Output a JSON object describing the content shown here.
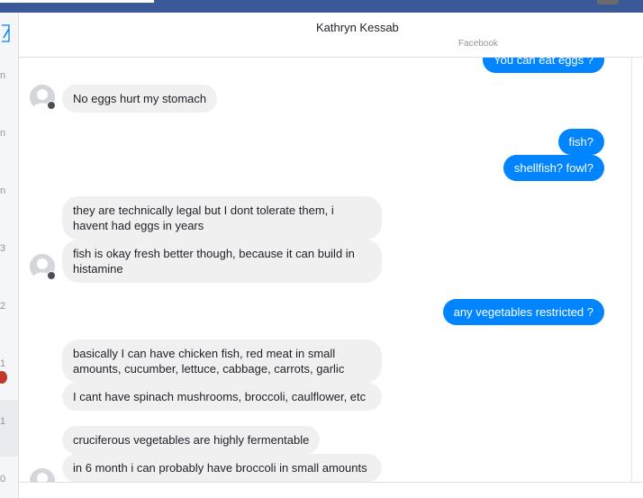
{
  "conversation": {
    "contact_name": "Kathryn Kessab",
    "contact_source": "Facebook"
  },
  "sidebar": {
    "counts": [
      "n",
      "n",
      "n",
      "3",
      "2",
      "1",
      "1",
      "0"
    ]
  },
  "messages": {
    "out_partial": "You can eat eggs ?",
    "in_1": "No eggs hurt my stomach",
    "out_1": "fish?",
    "out_2": "shellfish? fowl?",
    "in_2": "they are technically legal but I dont tolerate them, i havent had eggs in years",
    "in_3": "fish is okay fresh better though, because it can build in histamine",
    "out_3": "any vegetables restricted ?",
    "in_4": "basically I can have chicken fish, red meat in small amounts, cucumber, lettuce, cabbage, carrots, garlic",
    "in_5": "I cant have spinach mushrooms, broccoli, caulflower, etc",
    "in_6": "cruciferous vegetables are highly fermentable",
    "in_7": "in 6 month i can probably have broccoli in small amounts"
  },
  "colors": {
    "brand_bar": "#3b5998",
    "outgoing_bubble": "#0084ff",
    "incoming_bubble": "#f1f0f0"
  },
  "icons": [
    "compose-icon",
    "default-avatar-icon",
    "facebook-badge-icon"
  ]
}
